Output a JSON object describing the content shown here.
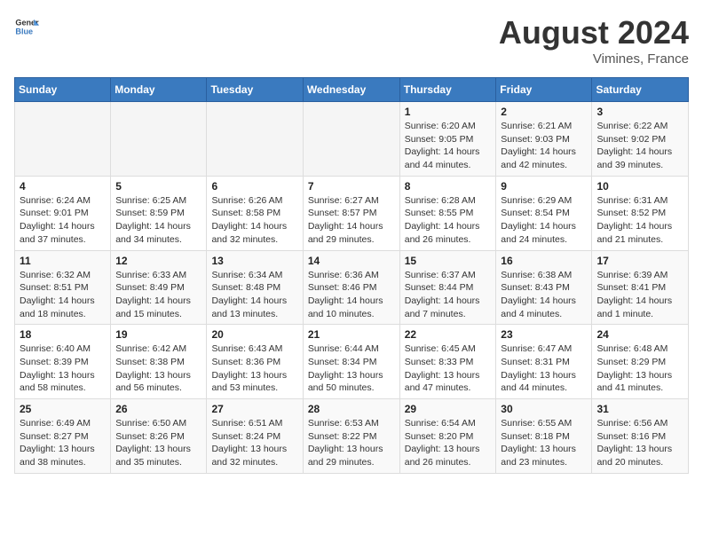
{
  "header": {
    "logo_general": "General",
    "logo_blue": "Blue",
    "title": "August 2024",
    "location": "Vimines, France"
  },
  "columns": [
    "Sunday",
    "Monday",
    "Tuesday",
    "Wednesday",
    "Thursday",
    "Friday",
    "Saturday"
  ],
  "weeks": [
    [
      {
        "day": "",
        "info": ""
      },
      {
        "day": "",
        "info": ""
      },
      {
        "day": "",
        "info": ""
      },
      {
        "day": "",
        "info": ""
      },
      {
        "day": "1",
        "info": "Sunrise: 6:20 AM\nSunset: 9:05 PM\nDaylight: 14 hours and 44 minutes."
      },
      {
        "day": "2",
        "info": "Sunrise: 6:21 AM\nSunset: 9:03 PM\nDaylight: 14 hours and 42 minutes."
      },
      {
        "day": "3",
        "info": "Sunrise: 6:22 AM\nSunset: 9:02 PM\nDaylight: 14 hours and 39 minutes."
      }
    ],
    [
      {
        "day": "4",
        "info": "Sunrise: 6:24 AM\nSunset: 9:01 PM\nDaylight: 14 hours and 37 minutes."
      },
      {
        "day": "5",
        "info": "Sunrise: 6:25 AM\nSunset: 8:59 PM\nDaylight: 14 hours and 34 minutes."
      },
      {
        "day": "6",
        "info": "Sunrise: 6:26 AM\nSunset: 8:58 PM\nDaylight: 14 hours and 32 minutes."
      },
      {
        "day": "7",
        "info": "Sunrise: 6:27 AM\nSunset: 8:57 PM\nDaylight: 14 hours and 29 minutes."
      },
      {
        "day": "8",
        "info": "Sunrise: 6:28 AM\nSunset: 8:55 PM\nDaylight: 14 hours and 26 minutes."
      },
      {
        "day": "9",
        "info": "Sunrise: 6:29 AM\nSunset: 8:54 PM\nDaylight: 14 hours and 24 minutes."
      },
      {
        "day": "10",
        "info": "Sunrise: 6:31 AM\nSunset: 8:52 PM\nDaylight: 14 hours and 21 minutes."
      }
    ],
    [
      {
        "day": "11",
        "info": "Sunrise: 6:32 AM\nSunset: 8:51 PM\nDaylight: 14 hours and 18 minutes."
      },
      {
        "day": "12",
        "info": "Sunrise: 6:33 AM\nSunset: 8:49 PM\nDaylight: 14 hours and 15 minutes."
      },
      {
        "day": "13",
        "info": "Sunrise: 6:34 AM\nSunset: 8:48 PM\nDaylight: 14 hours and 13 minutes."
      },
      {
        "day": "14",
        "info": "Sunrise: 6:36 AM\nSunset: 8:46 PM\nDaylight: 14 hours and 10 minutes."
      },
      {
        "day": "15",
        "info": "Sunrise: 6:37 AM\nSunset: 8:44 PM\nDaylight: 14 hours and 7 minutes."
      },
      {
        "day": "16",
        "info": "Sunrise: 6:38 AM\nSunset: 8:43 PM\nDaylight: 14 hours and 4 minutes."
      },
      {
        "day": "17",
        "info": "Sunrise: 6:39 AM\nSunset: 8:41 PM\nDaylight: 14 hours and 1 minute."
      }
    ],
    [
      {
        "day": "18",
        "info": "Sunrise: 6:40 AM\nSunset: 8:39 PM\nDaylight: 13 hours and 58 minutes."
      },
      {
        "day": "19",
        "info": "Sunrise: 6:42 AM\nSunset: 8:38 PM\nDaylight: 13 hours and 56 minutes."
      },
      {
        "day": "20",
        "info": "Sunrise: 6:43 AM\nSunset: 8:36 PM\nDaylight: 13 hours and 53 minutes."
      },
      {
        "day": "21",
        "info": "Sunrise: 6:44 AM\nSunset: 8:34 PM\nDaylight: 13 hours and 50 minutes."
      },
      {
        "day": "22",
        "info": "Sunrise: 6:45 AM\nSunset: 8:33 PM\nDaylight: 13 hours and 47 minutes."
      },
      {
        "day": "23",
        "info": "Sunrise: 6:47 AM\nSunset: 8:31 PM\nDaylight: 13 hours and 44 minutes."
      },
      {
        "day": "24",
        "info": "Sunrise: 6:48 AM\nSunset: 8:29 PM\nDaylight: 13 hours and 41 minutes."
      }
    ],
    [
      {
        "day": "25",
        "info": "Sunrise: 6:49 AM\nSunset: 8:27 PM\nDaylight: 13 hours and 38 minutes."
      },
      {
        "day": "26",
        "info": "Sunrise: 6:50 AM\nSunset: 8:26 PM\nDaylight: 13 hours and 35 minutes."
      },
      {
        "day": "27",
        "info": "Sunrise: 6:51 AM\nSunset: 8:24 PM\nDaylight: 13 hours and 32 minutes."
      },
      {
        "day": "28",
        "info": "Sunrise: 6:53 AM\nSunset: 8:22 PM\nDaylight: 13 hours and 29 minutes."
      },
      {
        "day": "29",
        "info": "Sunrise: 6:54 AM\nSunset: 8:20 PM\nDaylight: 13 hours and 26 minutes."
      },
      {
        "day": "30",
        "info": "Sunrise: 6:55 AM\nSunset: 8:18 PM\nDaylight: 13 hours and 23 minutes."
      },
      {
        "day": "31",
        "info": "Sunrise: 6:56 AM\nSunset: 8:16 PM\nDaylight: 13 hours and 20 minutes."
      }
    ]
  ]
}
